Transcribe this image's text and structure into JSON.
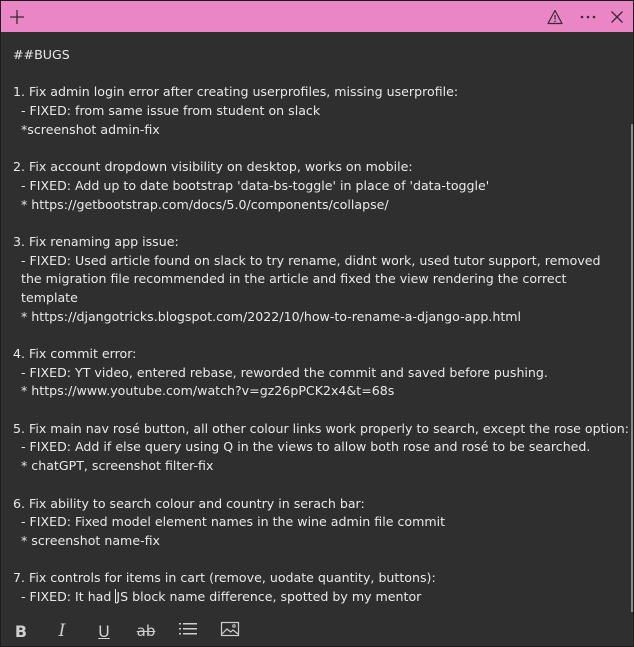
{
  "window": {
    "accent": "#ea86c6",
    "background": "#2f2f2f",
    "text_color": "#e9e9e9"
  },
  "titlebar": {
    "add_icon": "plus-icon",
    "warning_icon": "warning-icon",
    "more_icon": "more-icon",
    "close_icon": "close-icon"
  },
  "note": {
    "lines": [
      "##BUGS",
      "",
      "1. Fix admin login error after creating userprofiles, missing userprofile:",
      "  - FIXED: from same issue from student on slack",
      "  *screenshot admin-fix",
      "",
      "2. Fix account dropdown visibility on desktop, works on mobile:",
      "  - FIXED: Add up to date bootstrap 'data-bs-toggle' in place of 'data-toggle'",
      "  * https://getbootstrap.com/docs/5.0/components/collapse/",
      "",
      "3. Fix renaming app issue:",
      "  - FIXED: Used article found on slack to try rename, didnt work, used tutor support, removed",
      "  the migration file recommended in the article and fixed the view rendering the correct",
      "  template",
      "  * https://djangotricks.blogspot.com/2022/10/how-to-rename-a-django-app.html",
      "",
      "4. Fix commit error:",
      "  - FIXED: YT video, entered rebase, reworded the commit and saved before pushing.",
      "  * https://www.youtube.com/watch?v=gz26pPCK2x4&t=68s",
      "",
      "5. Fix main nav rosé button, all other colour links work properly to search, except the rose option:",
      "  - FIXED: Add if else query using Q in the views to allow both rose and rosé to be searched.",
      "  * chatGPT, screenshot filter-fix",
      "",
      "6. Fix ability to search colour and country in serach bar:",
      "  - FIXED: Fixed model element names in the wine admin file commit",
      "  * screenshot name-fix",
      "",
      "7. Fix controls for items in cart (remove, uodate quantity, buttons):"
    ],
    "last_line_before_caret": "  - FIXED: It had ",
    "last_line_after_caret": "JS block name difference, spotted by my mentor"
  },
  "toolbar": {
    "bold_label": "B",
    "italic_label": "I",
    "underline_label": "U",
    "strike_label": "ab",
    "list_icon": "bullet-list-icon",
    "image_icon": "image-icon"
  }
}
